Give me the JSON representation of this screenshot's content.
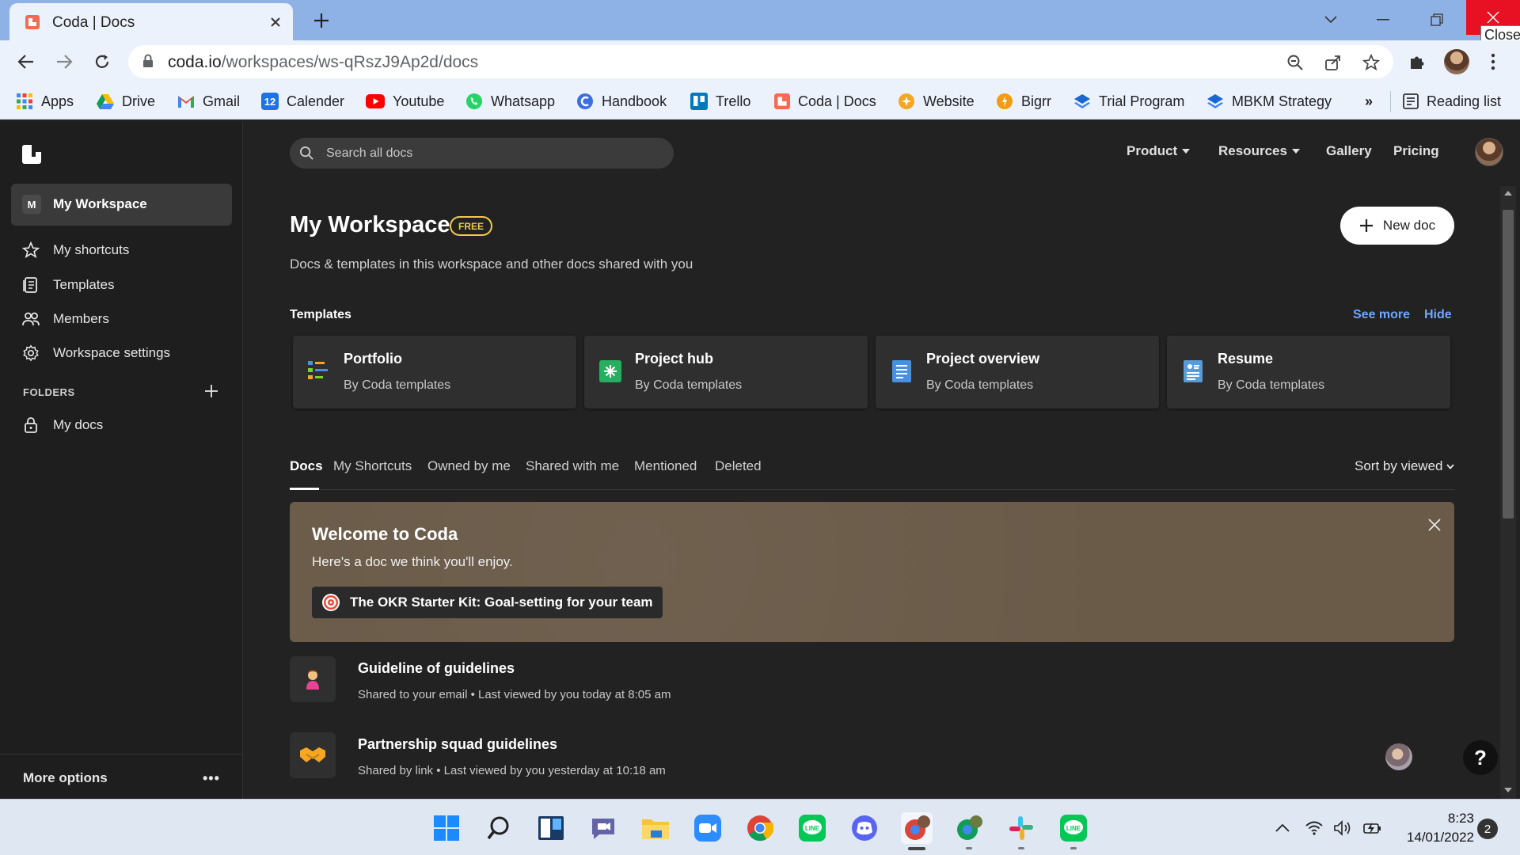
{
  "browser": {
    "tab_title": "Coda | Docs",
    "tooltip": "Close",
    "url_host": "coda.io",
    "url_path": "/workspaces/ws-qRszJ9Ap2d/docs"
  },
  "bookmarks": [
    {
      "label": "Apps",
      "icon": "apps-grid-icon",
      "color": "#4285f4"
    },
    {
      "label": "Drive",
      "icon": "google-drive-icon",
      "color": "#0f9d58"
    },
    {
      "label": "Gmail",
      "icon": "gmail-icon",
      "color": "#ea4335"
    },
    {
      "label": "Calender",
      "icon": "calendar-icon",
      "color": "#1a73e8"
    },
    {
      "label": "Youtube",
      "icon": "youtube-icon",
      "color": "#ff0000"
    },
    {
      "label": "Whatsapp",
      "icon": "whatsapp-icon",
      "color": "#25d366"
    },
    {
      "label": "Handbook",
      "icon": "handbook-icon",
      "color": "#3b6fe0"
    },
    {
      "label": "Trello",
      "icon": "trello-icon",
      "color": "#0079bf"
    },
    {
      "label": "Coda | Docs",
      "icon": "coda-icon",
      "color": "#f46a54"
    },
    {
      "label": "Website",
      "icon": "website-icon",
      "color": "#f5a623"
    },
    {
      "label": "Bigrr",
      "icon": "bigrr-icon",
      "color": "#f39c12"
    },
    {
      "label": "Trial Program",
      "icon": "layers-icon",
      "color": "#1967d2"
    },
    {
      "label": "MBKM Strategy",
      "icon": "layers-icon",
      "color": "#1967d2"
    }
  ],
  "bookmarks_more": "»",
  "reading_list": "Reading list",
  "sidebar": {
    "workspace_badge": "M",
    "workspace_label": "My Workspace",
    "items": [
      {
        "label": "My shortcuts",
        "icon": "star-icon"
      },
      {
        "label": "Templates",
        "icon": "templates-icon"
      },
      {
        "label": "Members",
        "icon": "members-icon"
      },
      {
        "label": "Workspace settings",
        "icon": "gear-icon"
      }
    ],
    "folders_heading": "FOLDERS",
    "folders": [
      {
        "label": "My docs",
        "icon": "lock-icon"
      }
    ],
    "more_options": "More options",
    "more_dots": "•••"
  },
  "header": {
    "search_placeholder": "Search all docs",
    "nav": [
      {
        "label": "Product",
        "dropdown": true
      },
      {
        "label": "Resources",
        "dropdown": true
      },
      {
        "label": "Gallery",
        "dropdown": false
      },
      {
        "label": "Pricing",
        "dropdown": false
      }
    ]
  },
  "main": {
    "title": "My Workspace",
    "badge": "FREE",
    "subtitle": "Docs & templates in this workspace and other docs shared with you",
    "new_doc": "New doc",
    "templates_heading": "Templates",
    "see_more": "See more",
    "hide": "Hide",
    "templates": [
      {
        "name": "Portfolio",
        "by": "By Coda templates",
        "icon": "portfolio-icon"
      },
      {
        "name": "Project hub",
        "by": "By Coda templates",
        "icon": "project-hub-icon"
      },
      {
        "name": "Project overview",
        "by": "By Coda templates",
        "icon": "document-icon"
      },
      {
        "name": "Resume",
        "by": "By Coda templates",
        "icon": "resume-icon"
      }
    ],
    "tabs": [
      "Docs",
      "My Shortcuts",
      "Owned by me",
      "Shared with me",
      "Mentioned",
      "Deleted"
    ],
    "active_tab": "Docs",
    "sort": "Sort by viewed",
    "welcome": {
      "title": "Welcome to Coda",
      "subtitle": "Here's a doc we think you'll enjoy.",
      "doc_button": "The OKR Starter Kit: Goal-setting for your team"
    },
    "docs": [
      {
        "name": "Guideline of guidelines",
        "meta": "Shared to your email • Last viewed by you today at 8:05 am",
        "icon": "person-emoji-icon"
      },
      {
        "name": "Partnership squad guidelines",
        "meta": "Shared by link • Last viewed by you yesterday at 10:18 am",
        "icon": "handshake-icon"
      }
    ],
    "help": "?"
  },
  "taskbar": {
    "time": "8:23",
    "date": "14/01/2022",
    "notifications": "2"
  },
  "colors": {
    "accent_link": "#6fa8ff",
    "free_badge": "#f2c94c",
    "welcome_bg": "#6a5a48",
    "close_red": "#e81123"
  }
}
